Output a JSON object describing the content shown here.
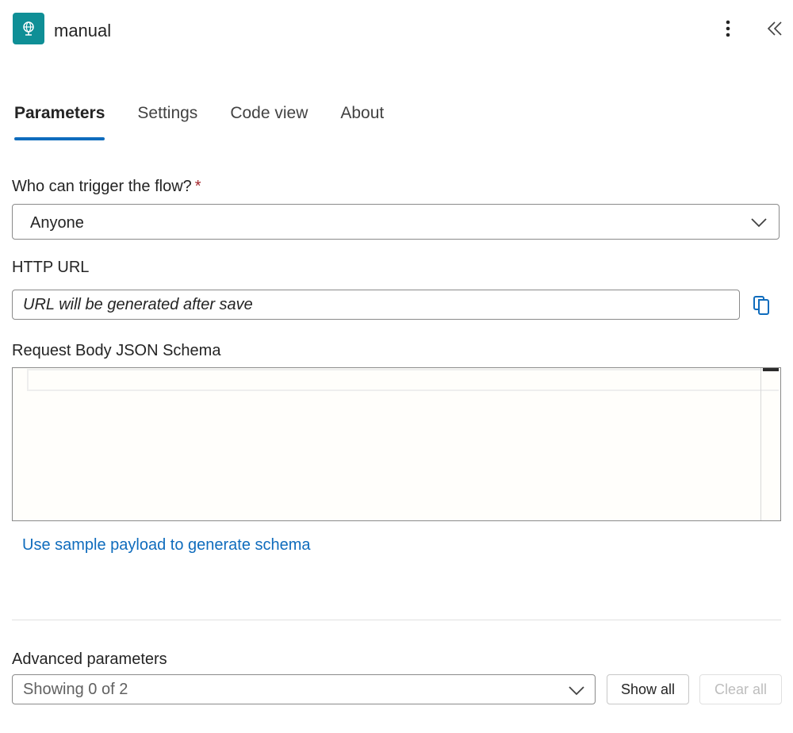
{
  "header": {
    "title": "manual",
    "app_icon": "globe-trigger-icon",
    "brand_color": "#0f8f96",
    "more_icon": "more-vertical-icon",
    "collapse_icon": "double-chevron-left-icon"
  },
  "tabs": [
    {
      "label": "Parameters",
      "active": true
    },
    {
      "label": "Settings",
      "active": false
    },
    {
      "label": "Code view",
      "active": false
    },
    {
      "label": "About",
      "active": false
    }
  ],
  "fields": {
    "who_can_trigger": {
      "label": "Who can trigger the flow?",
      "required_mark": "*",
      "value": "Anyone"
    },
    "http_url": {
      "label": "HTTP URL",
      "value": "URL will be generated after save"
    },
    "schema": {
      "label": "Request Body JSON Schema",
      "value": ""
    }
  },
  "sample_payload_link": "Use sample payload to generate schema",
  "advanced": {
    "label": "Advanced parameters",
    "value": "Showing 0 of 2",
    "show_all": "Show all",
    "clear_all": "Clear all"
  },
  "colors": {
    "accent": "#0f6cbd",
    "required": "#a4262c"
  }
}
